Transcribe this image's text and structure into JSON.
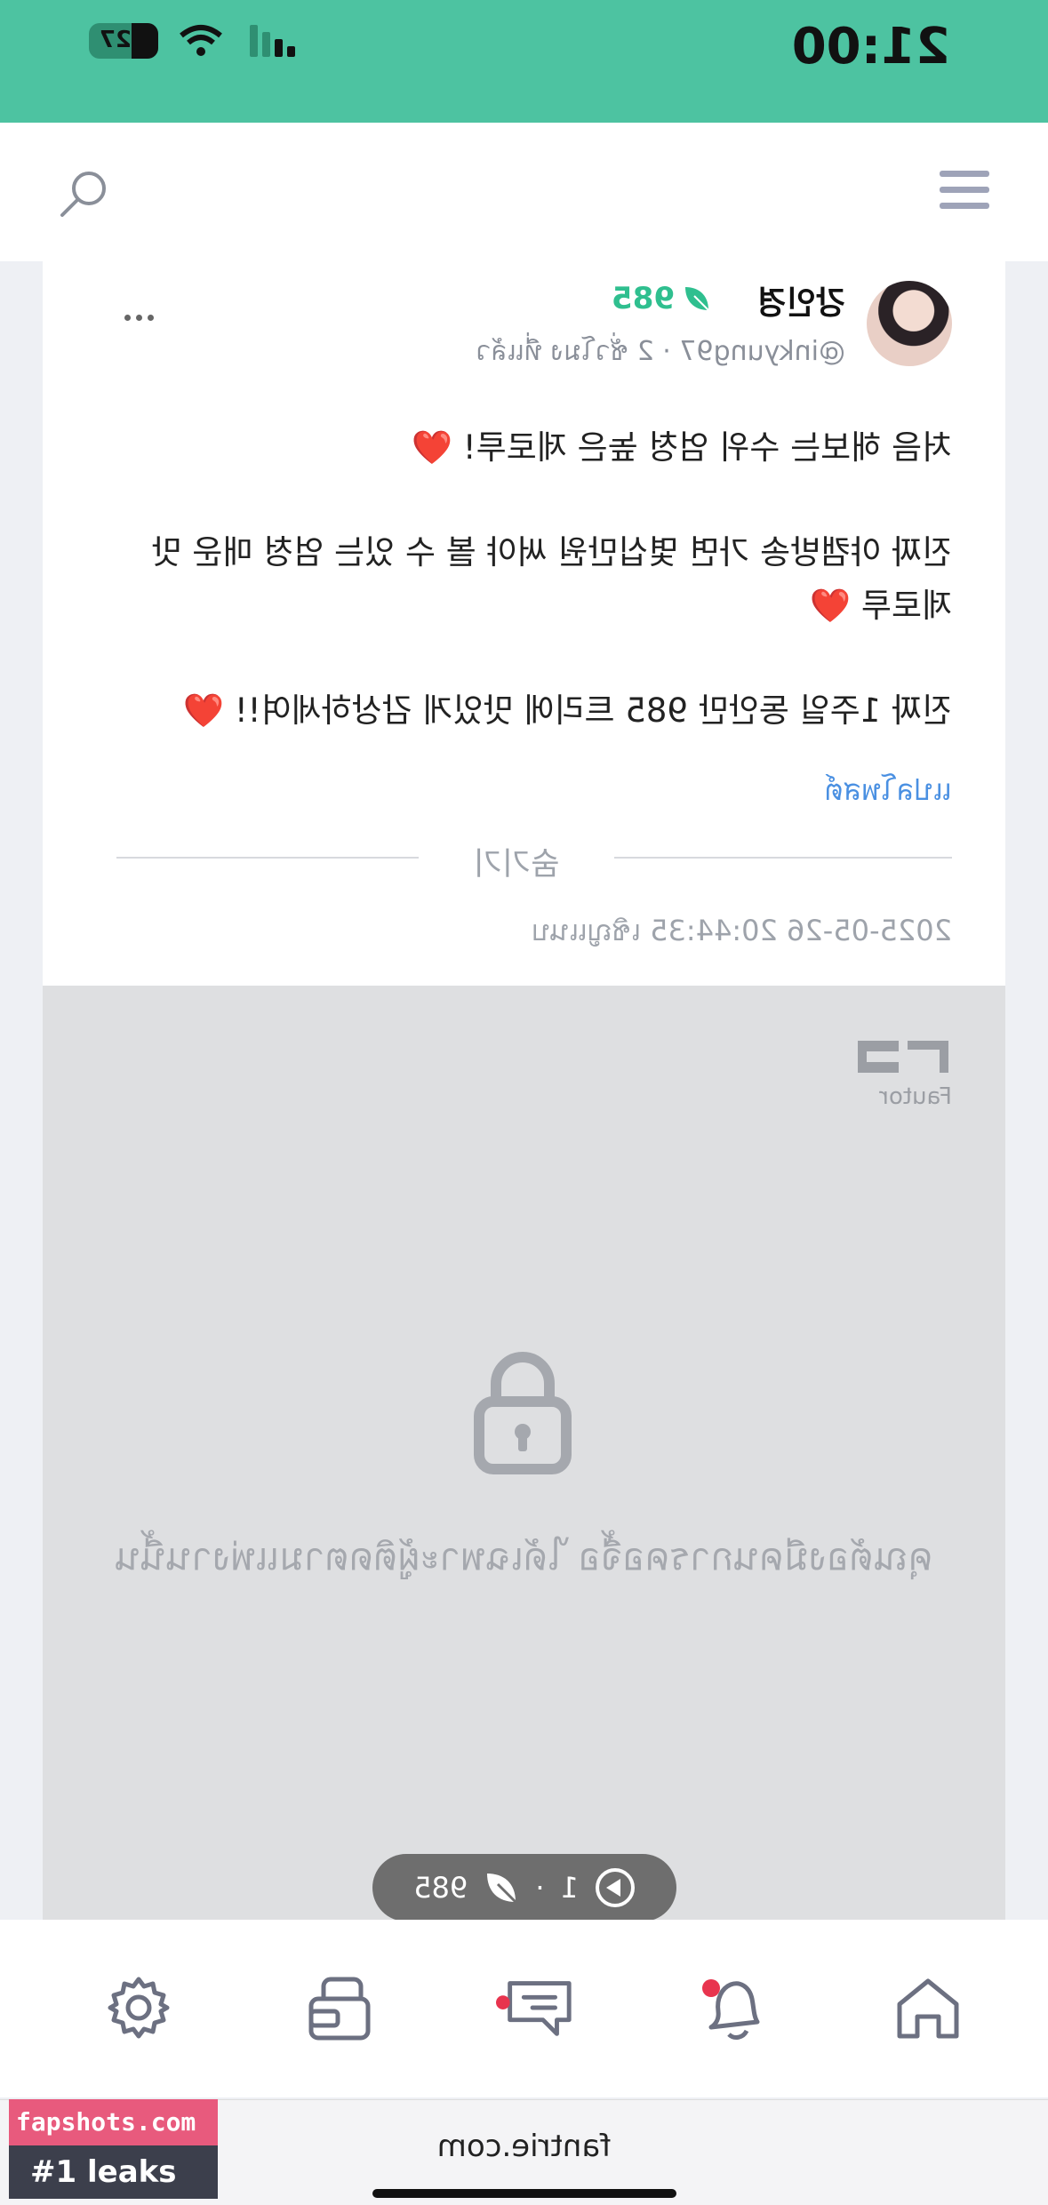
{
  "status_bar": {
    "time": "21:00",
    "battery": "27"
  },
  "post": {
    "author_name": "강인경",
    "author_handle": "@inkyung97",
    "posted_ago": "2 ชั่วโมง ที่แล้ว",
    "leaf_count": "985",
    "body": [
      "처음 해보는 수위 엄청 높은 제로루!",
      "진짜 야캠방송 가면 몇십만원 써야 볼 수 있는 엄청 매운 맛 제로루",
      "진짜 1주일 동안만 985 트리에 맛있게 감상하세여!!"
    ],
    "heart": "❤️",
    "see_translation": "แปลโพสต์",
    "hide_label": "숨기기",
    "datetime": "2025-05-26 20:44:35 เชิญแนบ"
  },
  "locked": {
    "logo_text": "Fautor",
    "message": "คุณต้องมีคนการคอจื้อ ได้เฉพาะผู้ติดตามแพ่งานนี้น"
  },
  "stats_pill": {
    "views": "1",
    "separator": "·",
    "leaves": "985"
  },
  "nav": {
    "items": [
      "home",
      "notifications",
      "messages",
      "wallet",
      "settings"
    ]
  },
  "browser": {
    "url": "fantrie.com"
  },
  "watermark": {
    "site": "fapshots.com",
    "tagline": "#1 leaks"
  }
}
